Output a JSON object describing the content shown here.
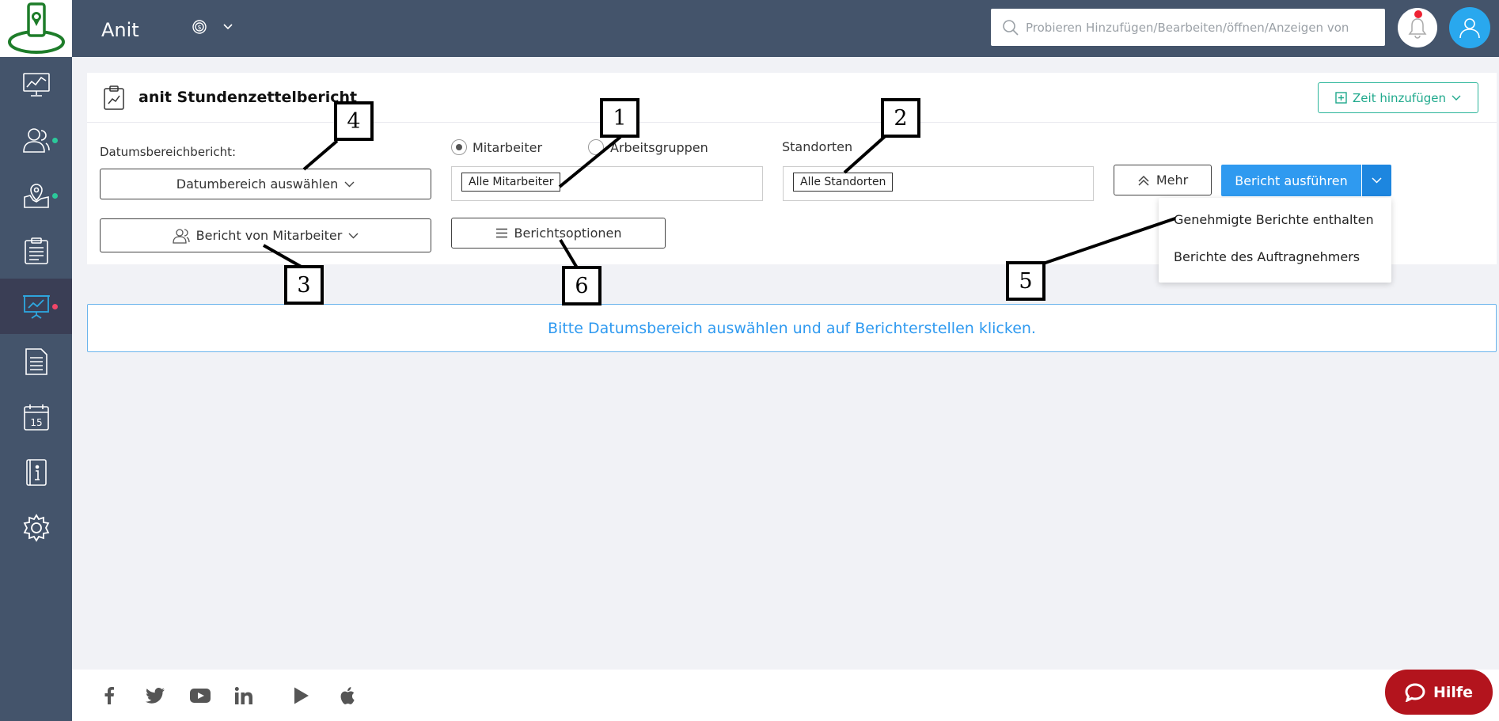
{
  "app": {
    "title": "Anit"
  },
  "search": {
    "placeholder": "Probieren Hinzufügen/Bearbeiten/öffnen/Anzeigen von"
  },
  "report": {
    "title": "anit Stundenzettelbericht",
    "add_time_label": "Zeit hinzufügen",
    "date_range_label": "Datumsbereichbericht:",
    "date_range_button": "Datumbereich auswählen",
    "employee_report_button": "Bericht von Mitarbeiter",
    "radio_employees": "Mitarbeiter",
    "radio_workgroups": "Arbeitsgruppen",
    "employees_chip": "Alle Mitarbeiter",
    "locations_label": "Standorten",
    "locations_chip": "Alle Standorten",
    "options_button": "Berichtsoptionen",
    "more_button": "Mehr",
    "run_button": "Bericht ausführen",
    "dropdown": [
      "Genehmigte Berichte enthalten",
      "Berichte des Auftragnehmers"
    ],
    "notice": "Bitte Datumsbereich auswählen und auf Berichterstellen klicken."
  },
  "help": {
    "label": "Hilfe"
  },
  "annotations": [
    "1",
    "2",
    "3",
    "4",
    "5",
    "6"
  ],
  "colors": {
    "header": "#44546b",
    "sidebar": "#44546b",
    "primary": "#2f9af0",
    "accent_green": "#1fa98c",
    "help": "#b3141d"
  }
}
